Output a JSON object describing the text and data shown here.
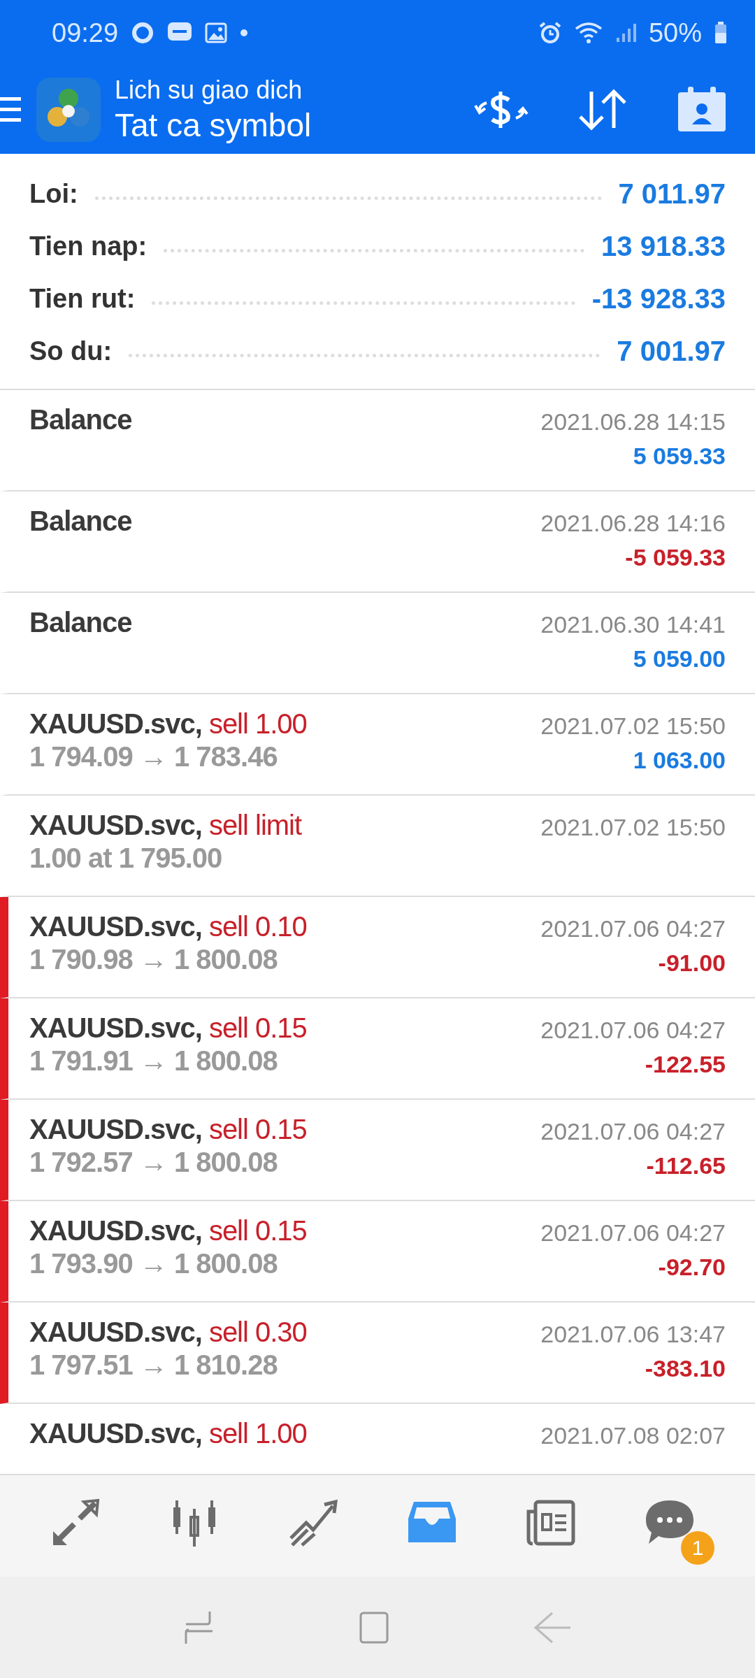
{
  "status_bar": {
    "time": "09:29",
    "battery": "50%"
  },
  "header": {
    "title": "Lich su giao dich",
    "subtitle": "Tat ca symbol"
  },
  "summary": [
    {
      "label": "Loi:",
      "value": "7 011.97"
    },
    {
      "label": "Tien nap:",
      "value": "13 918.33"
    },
    {
      "label": "Tien rut:",
      "value": "-13 928.33"
    },
    {
      "label": "So du:",
      "value": "7 001.97"
    }
  ],
  "transactions": [
    {
      "kind": "balance",
      "title": "Balance",
      "date": "2021.06.28 14:15",
      "profit": "5 059.33",
      "loss": false,
      "flagged": false
    },
    {
      "kind": "balance",
      "title": "Balance",
      "date": "2021.06.28 14:16",
      "profit": "-5 059.33",
      "loss": true,
      "flagged": false
    },
    {
      "kind": "balance",
      "title": "Balance",
      "date": "2021.06.30 14:41",
      "profit": "5 059.00",
      "loss": false,
      "flagged": false
    },
    {
      "kind": "deal",
      "title": "XAUUSD.svc,",
      "action": "sell 1.00",
      "prices": "1 794.09 → 1 783.46",
      "date": "2021.07.02 15:50",
      "profit": "1 063.00",
      "loss": false,
      "flagged": false
    },
    {
      "kind": "order",
      "title": "XAUUSD.svc,",
      "action": "sell limit",
      "prices": "1.00 at 1 795.00",
      "date": "2021.07.02 15:50",
      "flagged": false
    },
    {
      "kind": "deal",
      "title": "XAUUSD.svc,",
      "action": "sell 0.10",
      "prices": "1 790.98 → 1 800.08",
      "date": "2021.07.06 04:27",
      "profit": "-91.00",
      "loss": true,
      "flagged": true
    },
    {
      "kind": "deal",
      "title": "XAUUSD.svc,",
      "action": "sell 0.15",
      "prices": "1 791.91 → 1 800.08",
      "date": "2021.07.06 04:27",
      "profit": "-122.55",
      "loss": true,
      "flagged": true
    },
    {
      "kind": "deal",
      "title": "XAUUSD.svc,",
      "action": "sell 0.15",
      "prices": "1 792.57 → 1 800.08",
      "date": "2021.07.06 04:27",
      "profit": "-112.65",
      "loss": true,
      "flagged": true
    },
    {
      "kind": "deal",
      "title": "XAUUSD.svc,",
      "action": "sell 0.15",
      "prices": "1 793.90 → 1 800.08",
      "date": "2021.07.06 04:27",
      "profit": "-92.70",
      "loss": true,
      "flagged": true
    },
    {
      "kind": "deal",
      "title": "XAUUSD.svc,",
      "action": "sell 0.30",
      "prices": "1 797.51 → 1 810.28",
      "date": "2021.07.06 13:47",
      "profit": "-383.10",
      "loss": true,
      "flagged": true
    },
    {
      "kind": "partial",
      "title": "XAUUSD.svc,",
      "action": "sell 1.00",
      "date": "2021.07.08 02:07",
      "flagged": false
    }
  ],
  "bottom_nav": [
    {
      "kind": "quotes",
      "selected": false
    },
    {
      "kind": "chart",
      "selected": false
    },
    {
      "kind": "trade",
      "selected": false
    },
    {
      "kind": "history",
      "selected": true
    },
    {
      "kind": "news",
      "selected": false
    },
    {
      "kind": "chat",
      "selected": false,
      "badge": "1"
    }
  ]
}
